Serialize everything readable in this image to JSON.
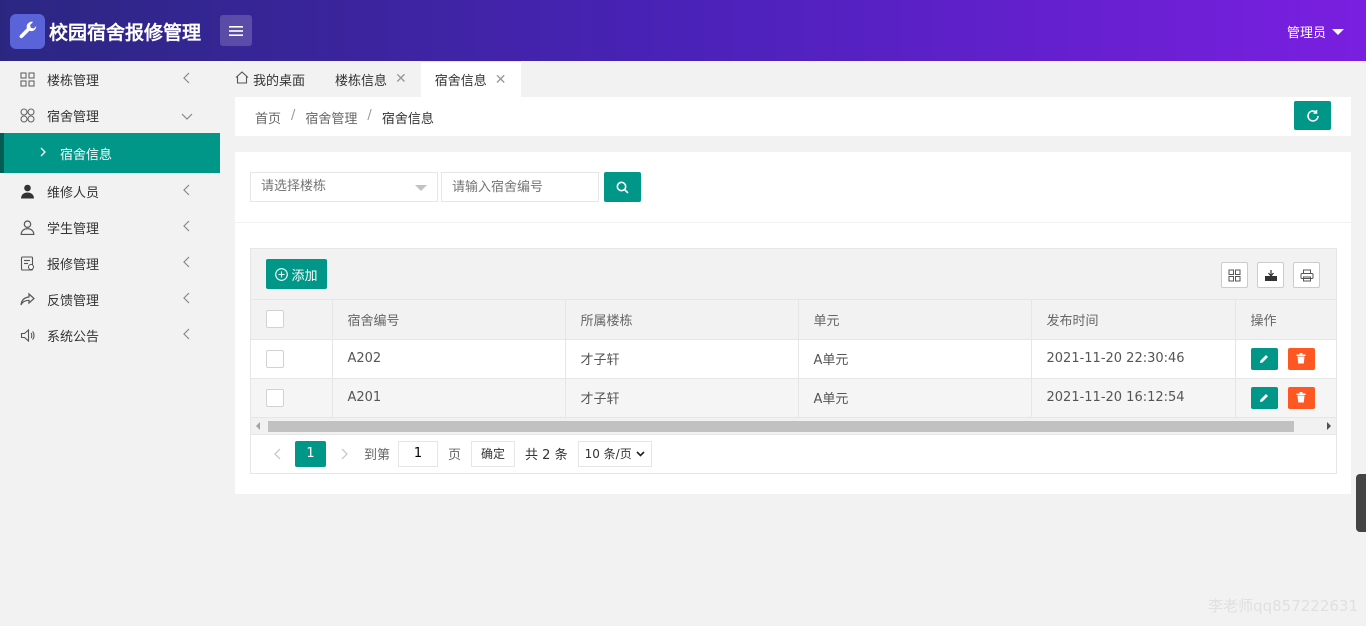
{
  "header": {
    "title": "校园宿舍报修管理",
    "user": "管理员",
    "colors": {
      "gradient_start": "#2b2781",
      "gradient_end": "#7a1fe0"
    }
  },
  "sidebar": {
    "items": [
      {
        "label": "楼栋管理",
        "icon": "grid-icon",
        "expanded": false
      },
      {
        "label": "宿舍管理",
        "icon": "clover-icon",
        "expanded": true
      },
      {
        "label": "宿舍信息",
        "icon": "chevron-right-icon",
        "active": true
      },
      {
        "label": "维修人员",
        "icon": "person-filled-icon",
        "expanded": false
      },
      {
        "label": "学生管理",
        "icon": "person-outline-icon",
        "expanded": false
      },
      {
        "label": "报修管理",
        "icon": "form-icon",
        "expanded": false
      },
      {
        "label": "反馈管理",
        "icon": "share-icon",
        "expanded": false
      },
      {
        "label": "系统公告",
        "icon": "speaker-icon",
        "expanded": false
      }
    ],
    "active_color": "#009688"
  },
  "tabs": [
    {
      "label": "我的桌面",
      "icon": "home-icon"
    },
    {
      "label": "楼栋信息",
      "closable": true
    },
    {
      "label": "宿舍信息",
      "closable": true,
      "active": true
    }
  ],
  "breadcrumb": [
    "首页",
    "宿舍管理",
    "宿舍信息"
  ],
  "search": {
    "building_placeholder": "请选择楼栋",
    "room_placeholder": "请输入宿舍编号"
  },
  "toolbar": {
    "add_label": "添加"
  },
  "table": {
    "columns": [
      "宿舍编号",
      "所属楼栋",
      "单元",
      "发布时间",
      "操作"
    ],
    "rows": [
      [
        "A202",
        "才子轩",
        "A单元",
        "2021-11-20 22:30:46"
      ],
      [
        "A201",
        "才子轩",
        "A单元",
        "2021-11-20 16:12:54"
      ]
    ]
  },
  "pager": {
    "current": "1",
    "goto_label": "到第",
    "goto_value": "1",
    "page_label": "页",
    "ok_label": "确定",
    "total_label": "共 2 条",
    "size_label": "10 条/页"
  },
  "watermark": "李老师qq857222631"
}
